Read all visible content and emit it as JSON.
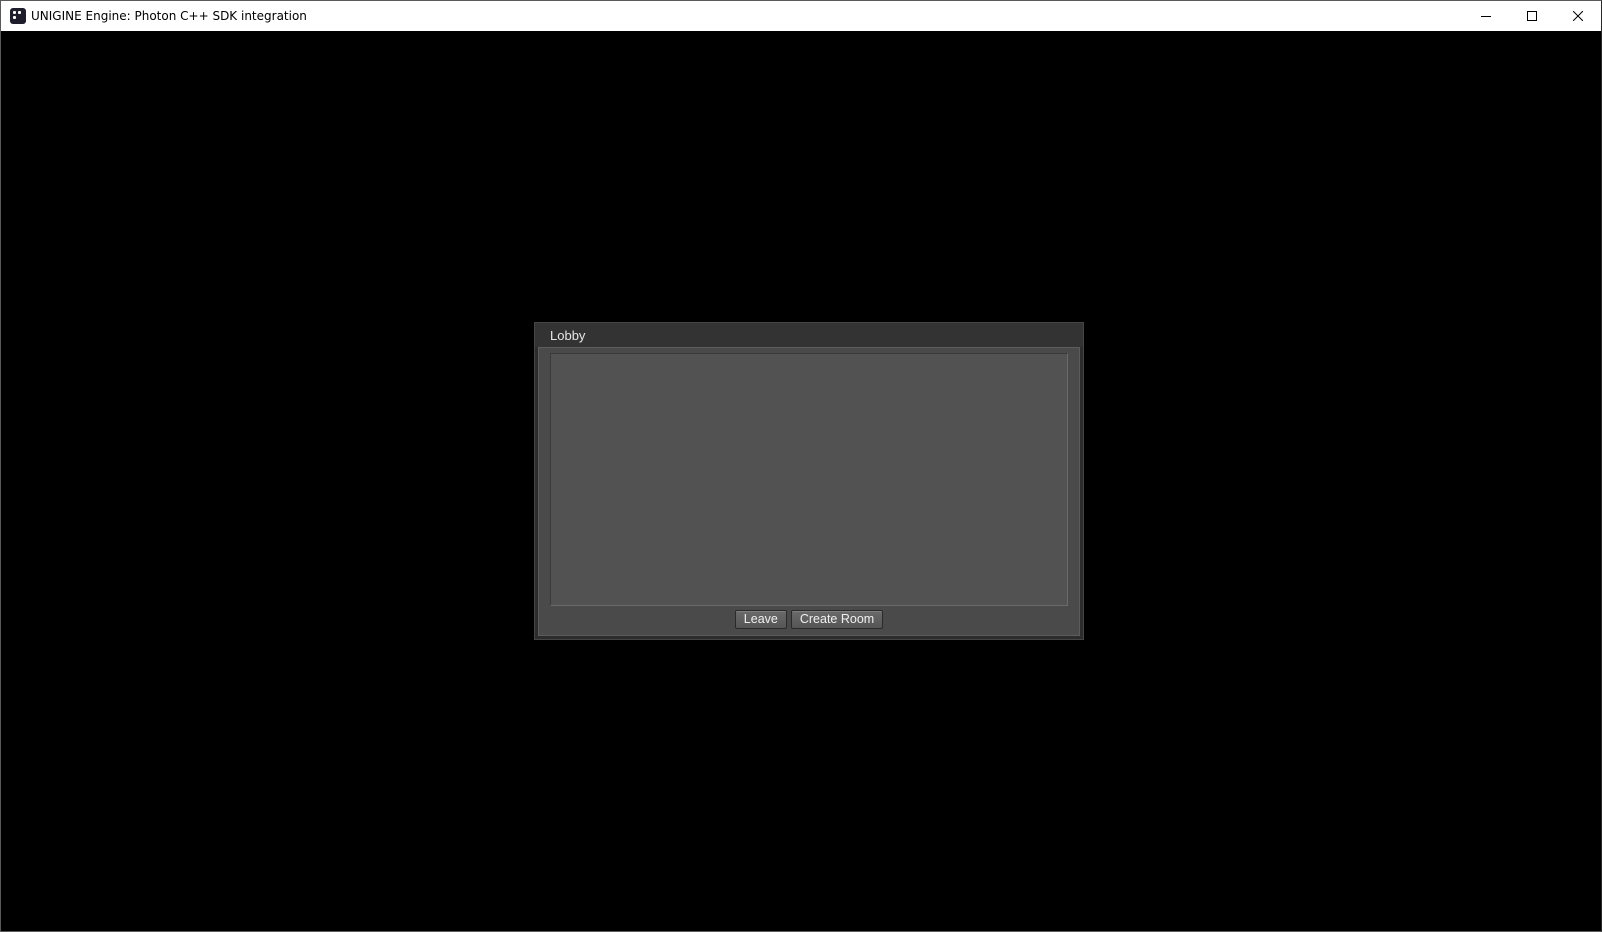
{
  "window": {
    "title": "UNIGINE Engine: Photon C++ SDK integration",
    "app_icon": "unigine-app-icon",
    "controls": {
      "minimize_icon": "minimize-icon",
      "maximize_icon": "maximize-icon",
      "close_icon": "close-icon"
    }
  },
  "lobby": {
    "title": "Lobby",
    "rooms": [],
    "buttons": {
      "leave_label": "Leave",
      "create_room_label": "Create Room"
    }
  },
  "colors": {
    "viewport_background": "#000000",
    "dialog_frame": "#2c2c2c",
    "dialog_body": "#4a4a4a",
    "list_background": "#525252",
    "button_background": "#606060",
    "text_light": "#e6e6e6"
  }
}
